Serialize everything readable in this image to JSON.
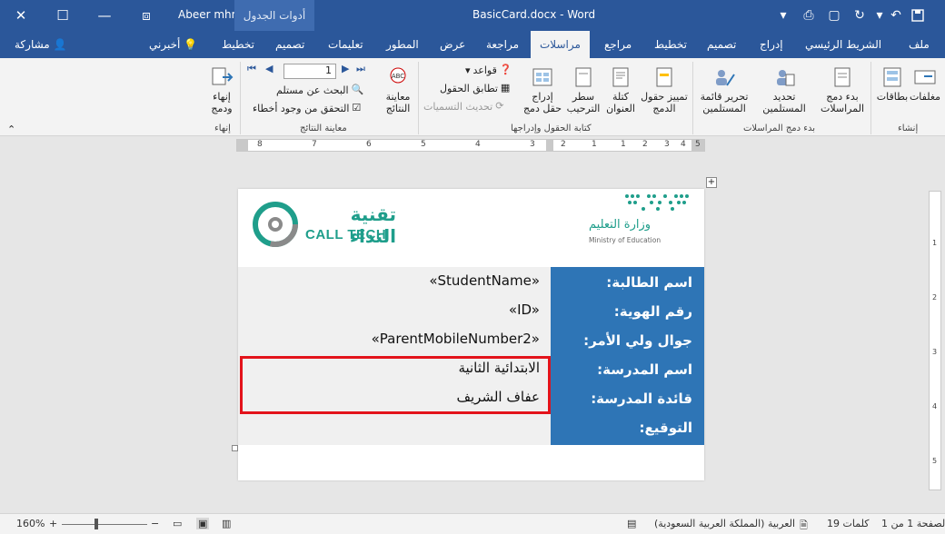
{
  "titlebar": {
    "doc_title": "BasicCard.docx  -  Word",
    "user": "Abeer mhm",
    "context_tab": "أدوات الجدول"
  },
  "tabs": [
    {
      "label": "ملف"
    },
    {
      "label": "الشريط الرئيسي"
    },
    {
      "label": "إدراج"
    },
    {
      "label": "تصميم"
    },
    {
      "label": "تخطيط"
    },
    {
      "label": "مراجع"
    },
    {
      "label": "مراسلات"
    },
    {
      "label": "مراجعة"
    },
    {
      "label": "عرض"
    },
    {
      "label": "المطور"
    },
    {
      "label": "تعليمات"
    },
    {
      "label": "تصميم"
    },
    {
      "label": "تخطيط"
    },
    {
      "label": "أخبرني"
    },
    {
      "label": "مشاركة"
    }
  ],
  "ribbon": {
    "create": {
      "envelopes": "مغلفات",
      "labels": "بطاقات",
      "group": "إنشاء"
    },
    "start": {
      "start_merge": "بدء دمج المراسلات",
      "select_recipients": "تحديد المستلمين",
      "edit_list": "تحرير قائمة المستلمين",
      "group": "بدء دمج المراسلات"
    },
    "fields": {
      "highlight": "تمييز حقول الدمج",
      "address_block": "كتلة العنوان",
      "greeting": "سطر الترحيب",
      "insert_field": "إدراج حقل دمج",
      "rules": "قواعد",
      "match_fields": "تطابق الحقول",
      "update_labels": "تحديث التسميات",
      "group": "كتابة الحقول وإدراجها"
    },
    "preview": {
      "preview_results": "معاينة النتائج",
      "record_number": "1",
      "find_recipient": "البحث عن مستلم",
      "check_errors": "التحقق من وجود أخطاء",
      "group": "معاينة النتائج"
    },
    "finish": {
      "finish_merge": "إنهاء ودمج",
      "group": "إنهاء"
    }
  },
  "ruler": {
    "h_numbers": [
      "8",
      "7",
      "6",
      "5",
      "4",
      "3",
      "2",
      "1",
      "1",
      "2",
      "3",
      "4",
      "5",
      "6"
    ],
    "v_numbers": [
      "1",
      "2",
      "3",
      "4",
      "5"
    ]
  },
  "card": {
    "logo_left": {
      "ar": "تقنية النداء",
      "en": "CALL TECH"
    },
    "logo_right": {
      "ar": "وزارة التعليم",
      "en": "Ministry of Education"
    },
    "rows": [
      {
        "label": "اسم الطالبة:",
        "value": "«StudentName»"
      },
      {
        "label": "رقم الهوية:",
        "value": "«ID»"
      },
      {
        "label": "جوال ولي الأمر:",
        "value": "«ParentMobileNumber2»"
      },
      {
        "label": "اسم المدرسة:",
        "value": "الابتدائية الثانية"
      },
      {
        "label": "قائدة المدرسة:",
        "value": "عفاف الشريف"
      },
      {
        "label": "التوقيع:",
        "value": ""
      }
    ]
  },
  "statusbar": {
    "page": "الصفحة 1 من 1",
    "words": "19 كلمات",
    "language": "العربية (المملكة العربية السعودية)",
    "zoom": "160%"
  }
}
